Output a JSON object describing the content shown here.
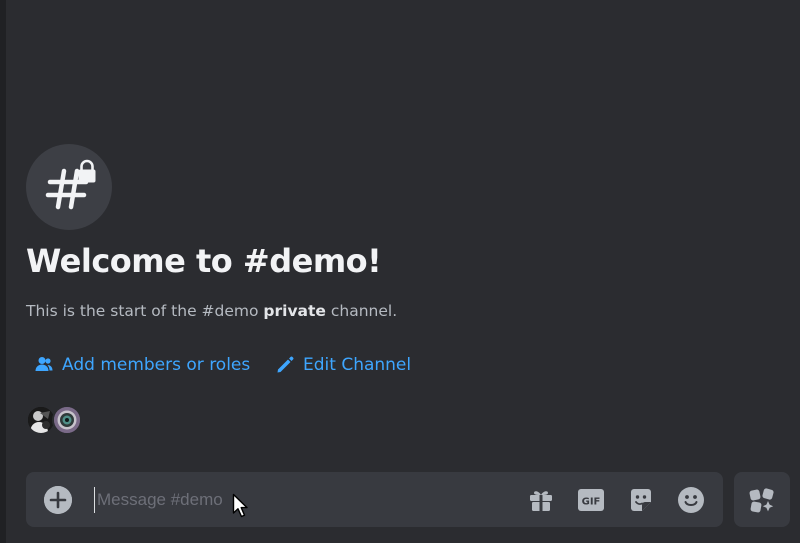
{
  "welcome": {
    "title": "Welcome to #demo!",
    "desc_prefix": "This is the start of the #demo ",
    "desc_bold": "private",
    "desc_suffix": " channel."
  },
  "actions": {
    "add_members_label": "Add members or roles",
    "edit_channel_label": "Edit Channel"
  },
  "composer": {
    "placeholder": "Message #demo",
    "gif_label": "GIF"
  },
  "icons": {
    "channel": "hashtag-lock-icon",
    "add_members": "people-icon",
    "edit_channel": "pencil-icon",
    "plus": "plus-circle-icon",
    "gift": "gift-icon",
    "gif": "gif-icon",
    "sticker": "sticker-icon",
    "emoji": "emoji-icon",
    "apps": "apps-icon"
  },
  "colors": {
    "background": "#2b2c30",
    "link": "#3ea6ff",
    "composer": "#383a40"
  }
}
